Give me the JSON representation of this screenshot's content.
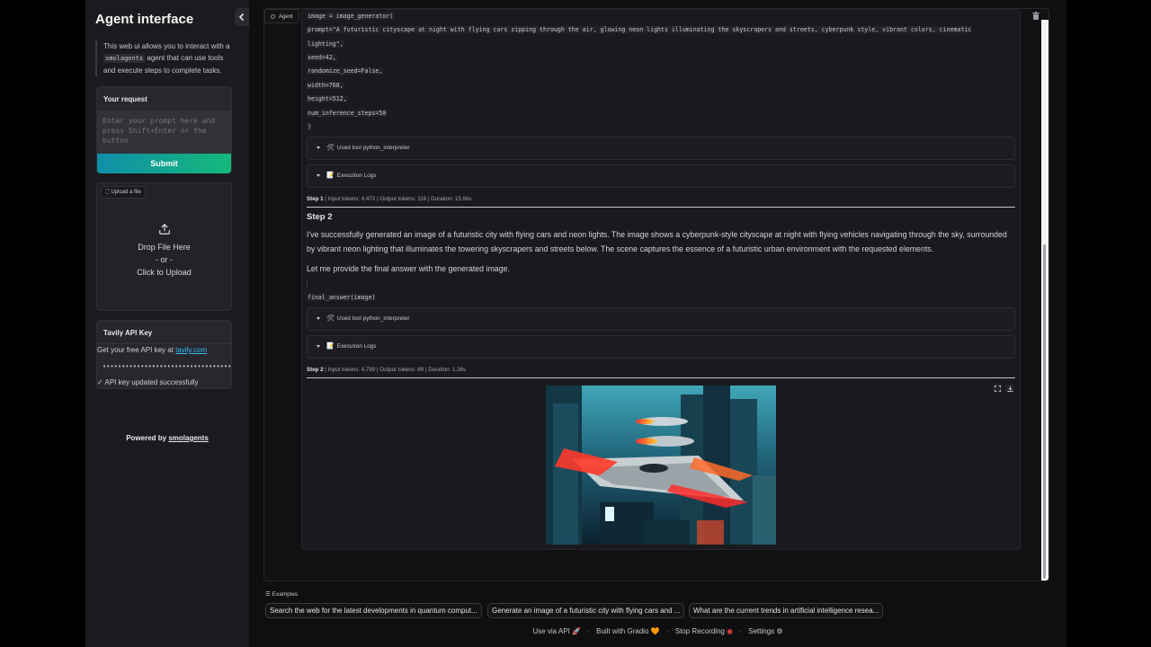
{
  "sidebar": {
    "title": "Agent interface",
    "intro_pre": "This web ui allows you to interact with a ",
    "intro_code": "smolagents",
    "intro_post": " agent that can use tools and execute steps to complete tasks.",
    "request_title": "Your request",
    "prompt_placeholder": "Enter your prompt here and press Shift+Enter or the button",
    "submit_label": "Submit",
    "upload_tag": "Upload a file",
    "upload_line1": "Drop File Here",
    "upload_line2": "- or -",
    "upload_line3": "Click to Upload",
    "api_title": "Tavily API Key",
    "api_text": "Get your free API key at ",
    "api_link": "tavily.com",
    "api_value": "••••••••••••••••••••••••••••••••••••••",
    "api_status": "✓ API key updated successfully",
    "powered_pre": "Powered by ",
    "powered_link": "smolagents"
  },
  "chat": {
    "agent_label": "Agent",
    "code_lines": [
      "image = image_generator(",
      "prompt=\"A futuristic cityscape at night with flying cars zipping through the air, glowing neon lights illuminating the skyscrapers and streets, cyberpunk style, vibrant colors, cinematic",
      "lighting\",",
      "seed=42,",
      "randomize_seed=False,",
      "width=768,",
      "height=512,",
      "num_inference_steps=50",
      ")"
    ],
    "accordion_tool_1": "Used tool python_interpreter",
    "accordion_logs_1": "Execution Logs",
    "step1_label": "Step 1",
    "step1_meta": " | Input tokens: 4,472 | Output tokens: 116 | Duration: 15.66s",
    "step2_title": "Step 2",
    "step2_text": "I've successfully generated an image of a futuristic city with flying cars and neon lights. The image shows a cyberpunk-style cityscape at night with flying vehicles navigating through the sky, surrounded by vibrant neon lighting that illuminates the towering skyscrapers and streets below. The scene captures the essence of a futuristic urban environment with the requested elements.",
    "step2_provide": "Let me provide the final answer with the generated image.",
    "final_code": "final_answer(image)",
    "accordion_tool_2": "Used tool python_interpreter",
    "accordion_logs_2": "Execution Logs",
    "step2_label": "Step 2",
    "step2_meta": " | Input tokens: 4,799 | Output tokens: 89 | Duration: 1.36s"
  },
  "examples": {
    "title": "Examples",
    "items": [
      "Search the web for the latest developments in quantum comput...",
      "Generate an image of a futuristic city with flying cars and ...",
      "What are the current trends in artificial intelligence resea..."
    ]
  },
  "footer": {
    "api": "Use via API",
    "gradio": "Built with Gradio",
    "recording": "Stop Recording",
    "settings": "Settings"
  },
  "icons": {
    "tool": "hammer-wrench-icon",
    "logs": "memo-icon",
    "fullscreen": "fullscreen-icon",
    "download": "download-icon",
    "trash": "trash-icon"
  },
  "colors": {
    "accent_gradient_start": "#0f8fa8",
    "accent_gradient_end": "#15b97a",
    "link": "#38bdf8",
    "record": "#ef4444"
  }
}
